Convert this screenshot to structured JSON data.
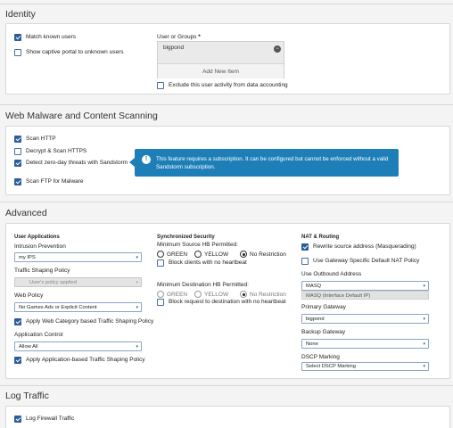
{
  "identity": {
    "title": "Identity",
    "match_known_users": "Match known users",
    "show_captive_portal": "Show captive portal to unknown users",
    "user_or_groups_label": "User or Groups",
    "required_mark": "*",
    "user_item": "bigpond",
    "add_new_item": "Add New Item",
    "exclude_activity": "Exclude this user activity from data accounting"
  },
  "malware": {
    "title": "Web Malware and Content Scanning",
    "scan_http": "Scan HTTP",
    "decrypt_scan_https": "Decrypt & Scan HTTPS",
    "detect_zero_day": "Detect zero-day threats with Sandstorm",
    "scan_ftp": "Scan FTP for Malware",
    "tooltip_text": "This feature requires a subscription. It can be configured but cannot be enforced without a valid Sandstorm subscription."
  },
  "advanced": {
    "title": "Advanced",
    "user_applications": {
      "heading": "User Applications",
      "intrusion_prevention_label": "Intrusion Prevention",
      "intrusion_prevention_value": "my IPS",
      "traffic_shaping_label": "Traffic Shaping Policy",
      "traffic_shaping_value": "User's policy applied",
      "web_policy_label": "Web Policy",
      "web_policy_value": "No Games Ads or Explicit Content",
      "apply_web_category": "Apply Web Category based Traffic Shaping Policy",
      "application_control_label": "Application Control",
      "application_control_value": "Allow All",
      "apply_app_based": "Apply Application-based Traffic Shaping Policy"
    },
    "synchronized_security": {
      "heading": "Synchronized Security",
      "min_source_label": "Minimum Source HB Permitted:",
      "green": "GREEN",
      "yellow": "YELLOW",
      "no_restriction": "No Restriction",
      "block_clients": "Block clients with no heartbeat",
      "min_dest_label": "Minimum Destination HB Permitted:",
      "block_request": "Block request to destination with no heartbeat"
    },
    "nat_routing": {
      "heading": "NAT & Routing",
      "rewrite_source": "Rewrite source address (Masquerading)",
      "use_gateway_nat": "Use Gateway Specific Default NAT Policy",
      "use_outbound_label": "Use Outbound Address",
      "outbound_value": "MASQ",
      "outbound_hint": "MASQ (Interface Default IP)",
      "primary_gateway_label": "Primary Gateway",
      "primary_gateway_value": "bigpond",
      "backup_gateway_label": "Backup Gateway",
      "backup_gateway_value": "None",
      "dscp_label": "DSCP Marking",
      "dscp_value": "Select DSCP Marking"
    }
  },
  "log_traffic": {
    "title": "Log Traffic",
    "log_firewall": "Log Firewall Traffic"
  },
  "icons": {
    "caret": "▾",
    "remove": "⊖",
    "info": "!"
  },
  "colors": {
    "accent": "#2a5d99",
    "tooltip": "#1e7fb8"
  }
}
